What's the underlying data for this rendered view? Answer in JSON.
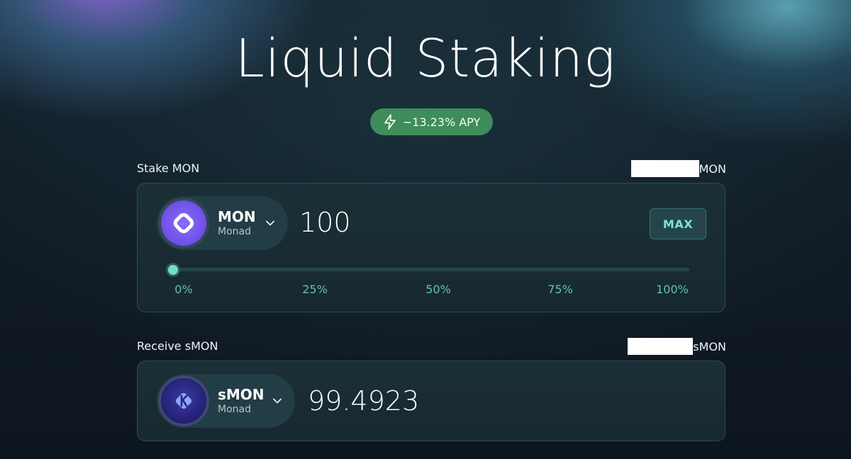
{
  "page": {
    "title": "Liquid Staking",
    "apy_badge": "~13.23% APY"
  },
  "stake": {
    "label": "Stake MON",
    "balance_unit": "MON",
    "token_symbol": "MON",
    "token_name": "Monad",
    "token_icon": "monad-logo-icon",
    "amount": "100",
    "max_label": "MAX",
    "slider_value_percent": 0,
    "slider_ticks": [
      "0%",
      "25%",
      "50%",
      "75%",
      "100%"
    ]
  },
  "receive": {
    "label": "Receive sMON",
    "balance_unit": "sMON",
    "token_symbol": "sMON",
    "token_name": "Monad",
    "token_icon": "smon-logo-icon",
    "amount": "99.4923"
  },
  "colors": {
    "accent_teal": "#6fe0cf",
    "apy_green": "#3f8d5a",
    "mon_purple": "#7b5cf0",
    "card_border": "#2d4b52"
  }
}
